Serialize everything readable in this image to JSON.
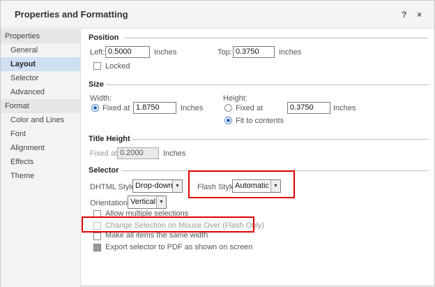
{
  "dialog": {
    "title": "Properties and Formatting",
    "help_label": "?",
    "close_label": "×"
  },
  "sidebar": {
    "properties_header": "Properties",
    "properties_items": [
      "General",
      "Layout",
      "Selector",
      "Advanced"
    ],
    "format_header": "Format",
    "format_items": [
      "Color and Lines",
      "Font",
      "Alignment",
      "Effects",
      "Theme"
    ],
    "active_item": "Layout"
  },
  "position": {
    "title": "Position",
    "left_label": "Left:",
    "left_value": "0.5000",
    "left_unit": "Inches",
    "top_label": "Top:",
    "top_value": "0.3750",
    "top_unit": "Inches",
    "locked_label": "Locked",
    "locked": false
  },
  "size": {
    "title": "Size",
    "width_label": "Width:",
    "width_fixed_label": "Fixed at",
    "width_value": "1.8750",
    "width_unit": "Inches",
    "height_label": "Height:",
    "height_fixed_label": "Fixed at",
    "height_value": "0.3750",
    "height_unit": "Inches",
    "fit_label": "Fit to contents",
    "width_mode": "fixed",
    "height_mode": "fit"
  },
  "title_height": {
    "title": "Title Height",
    "fixed_label": "Fixed at",
    "value": "0.2000",
    "unit": "Inches"
  },
  "selector": {
    "title": "Selector",
    "dhtml_label": "DHTML Style:",
    "dhtml_value": "Drop-down",
    "flash_label": "Flash Style:",
    "flash_value": "Automatic",
    "orientation_label": "Orientation:",
    "orientation_value": "Vertical",
    "allow_multiple_label": "Allow multiple selections",
    "change_on_mouseover_label": "Change Selection on Mouse Over (Flash Only)",
    "same_width_label": "Make all items the same width",
    "export_pdf_label": "Export selector to PDF as shown on screen"
  },
  "highlight_color": "#e00000",
  "accent_color": "#1e62b8"
}
